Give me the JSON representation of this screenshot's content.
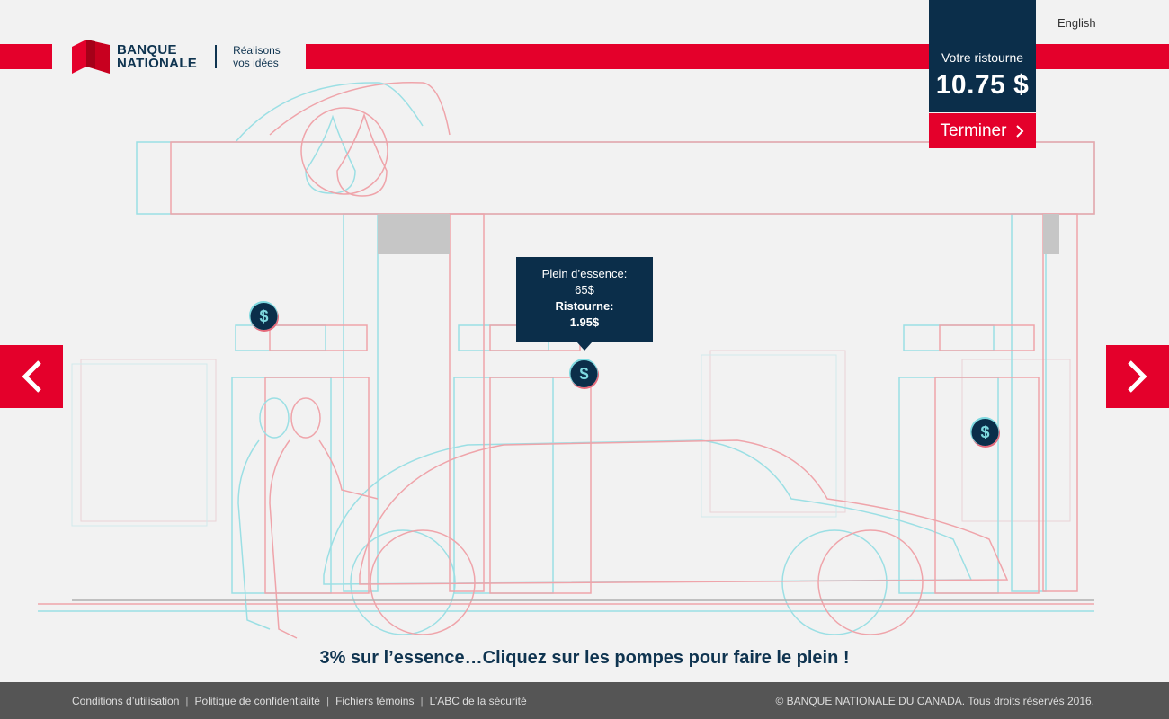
{
  "brand": {
    "name_line1": "BANQUE",
    "name_line2": "NATIONALE",
    "tagline_line1": "Réalisons",
    "tagline_line2": "vos idées",
    "red": "#e4002b",
    "navy": "#0b2e4a"
  },
  "header": {
    "language_link": "English"
  },
  "rebate": {
    "label": "Votre ristourne",
    "value": "10.75 $",
    "finish_label": "Terminer"
  },
  "tooltip": {
    "line1": "Plein d’essence:",
    "line2": "65$",
    "line3": "Ristourne:",
    "line4": "1.95$"
  },
  "coins": {
    "symbol": "$"
  },
  "navigation": {
    "prev_icon": "chevron-left-icon",
    "next_icon": "chevron-right-icon"
  },
  "instruction": "3% sur l’essence…Cliquez sur les pompes pour faire le plein !",
  "footer": {
    "links": [
      "Conditions d’utilisation",
      "Politique de confidentialité",
      "Fichiers témoins",
      "L’ABC de la sécurité"
    ],
    "separator": "|",
    "copyright": "© BANQUE NATIONALE DU CANADA. Tous droits réservés 2016."
  }
}
